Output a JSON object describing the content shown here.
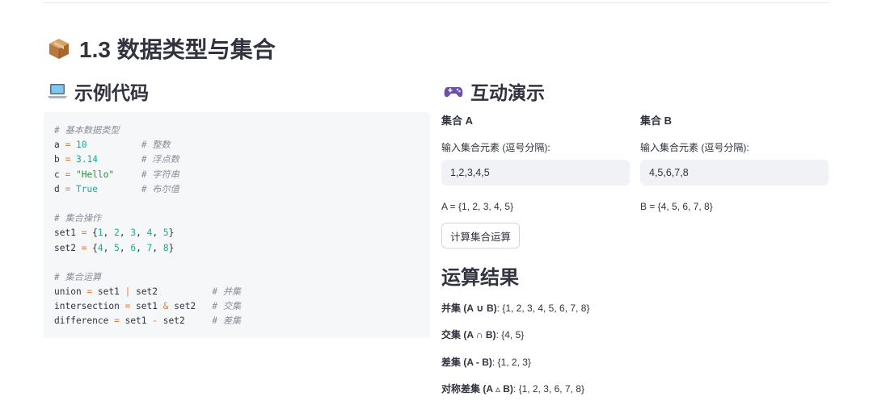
{
  "page": {
    "title": "1.3 数据类型与集合",
    "title_icon": "package-icon"
  },
  "code_section": {
    "title": "示例代码",
    "icon": "laptop-icon",
    "lines": [
      "# 基本数据类型",
      "a = 10          # 整数",
      "b = 3.14        # 浮点数",
      "c = \"Hello\"     # 字符串",
      "d = True        # 布尔值",
      "",
      "# 集合操作",
      "set1 = {1, 2, 3, 4, 5}",
      "set2 = {4, 5, 6, 7, 8}",
      "",
      "# 集合运算",
      "union = set1 | set2          # 并集",
      "intersection = set1 & set2   # 交集",
      "difference = set1 - set2     # 差集"
    ]
  },
  "demo_section": {
    "title": "互动演示",
    "icon": "gamepad-icon",
    "set_a": {
      "label": "集合 A",
      "caption": "输入集合元素 (逗号分隔):",
      "value": "1,2,3,4,5",
      "display": "A = {1, 2, 3, 4, 5}"
    },
    "set_b": {
      "label": "集合 B",
      "caption": "输入集合元素 (逗号分隔):",
      "value": "4,5,6,7,8",
      "display": "B = {4, 5, 6, 7, 8}"
    },
    "compute_button": "计算集合运算"
  },
  "results": {
    "title": "运算结果",
    "items": [
      {
        "label": "并集 (A ∪ B)",
        "value": ": {1, 2, 3, 4, 5, 6, 7, 8}"
      },
      {
        "label": "交集 (A ∩ B)",
        "value": ": {4, 5}"
      },
      {
        "label": "差集 (A - B)",
        "value": ": {1, 2, 3}"
      },
      {
        "label": "对称差集 (A ▵ B)",
        "value": ": {1, 2, 3, 6, 7, 8}"
      }
    ]
  },
  "colors": {
    "text": "#31333f",
    "code_bg": "#f6f7f9",
    "input_bg": "#f0f2f6",
    "code_number": "#1ba89a",
    "code_string": "#2e8b3a",
    "code_operator": "#e07b39",
    "code_comment": "#8a8f99"
  }
}
